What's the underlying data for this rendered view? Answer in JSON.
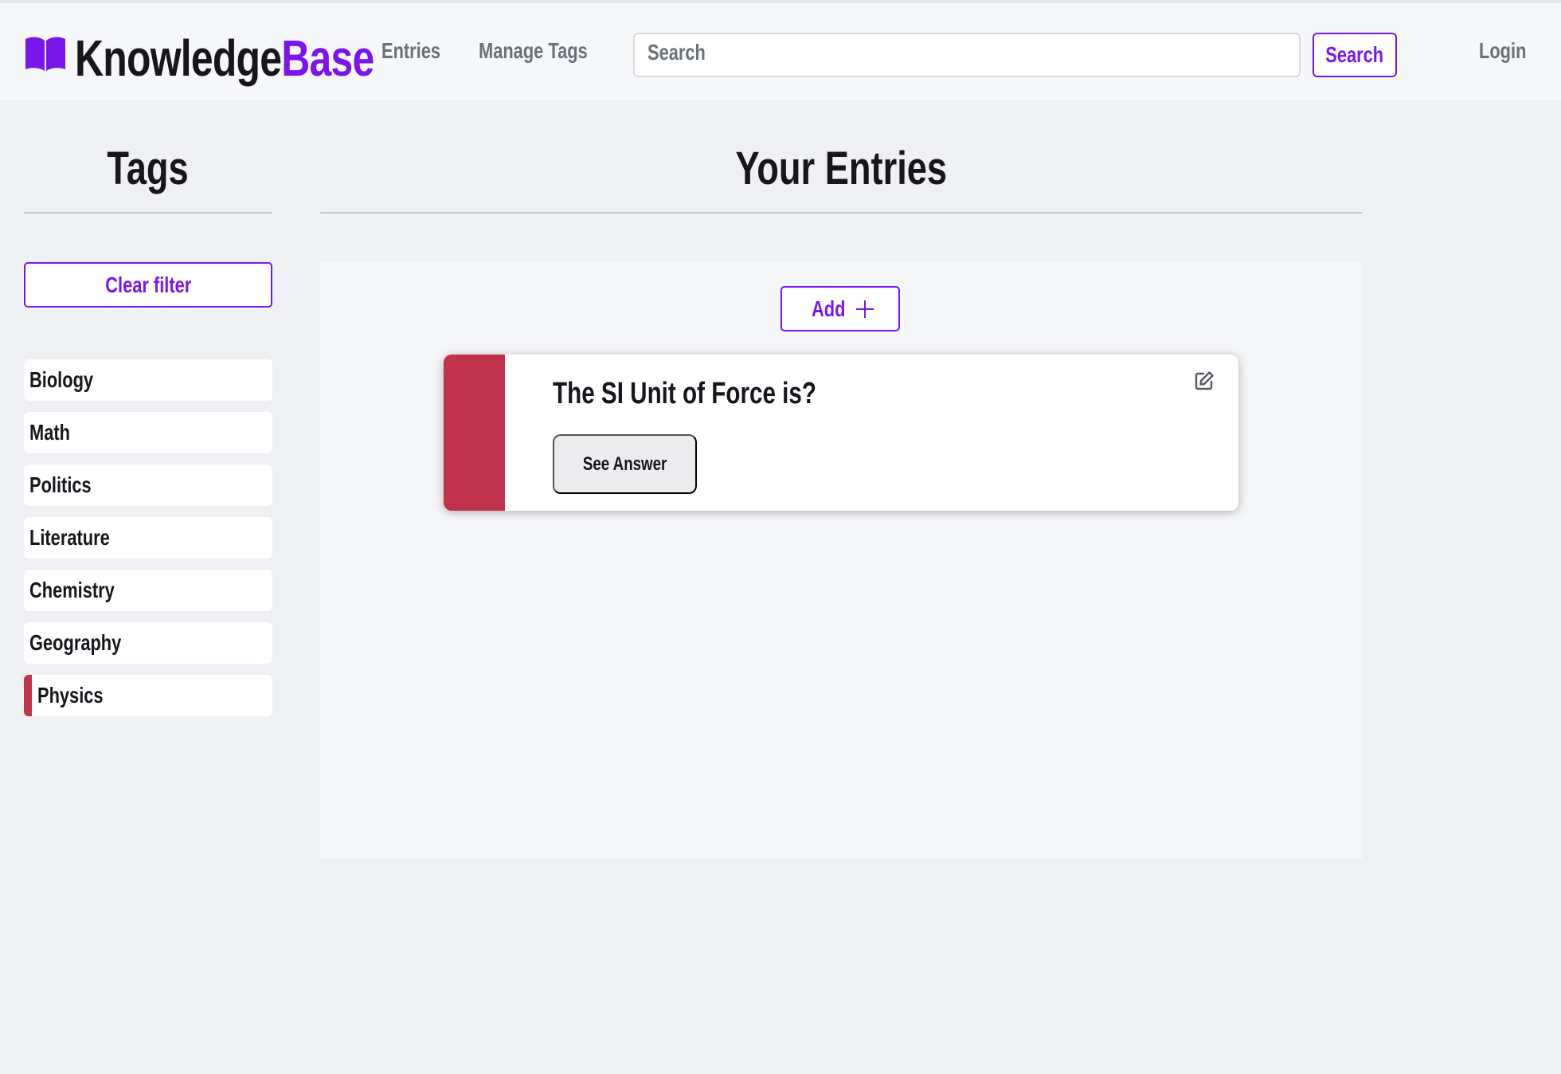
{
  "header": {
    "logo": {
      "part1": "Knowledge",
      "part2": "Base",
      "icon": "book-icon"
    },
    "nav": [
      {
        "label": "Entries"
      },
      {
        "label": "Manage Tags"
      }
    ],
    "search": {
      "placeholder": "Search",
      "value": "",
      "button_label": "Search"
    },
    "login_label": "Login"
  },
  "sidebar": {
    "title": "Tags",
    "clear_label": "Clear filter",
    "tags": [
      {
        "label": "Biology",
        "active": false
      },
      {
        "label": "Math",
        "active": false
      },
      {
        "label": "Politics",
        "active": false
      },
      {
        "label": "Literature",
        "active": false
      },
      {
        "label": "Chemistry",
        "active": false
      },
      {
        "label": "Geography",
        "active": false
      },
      {
        "label": "Physics",
        "active": true,
        "color": "#c0334a"
      }
    ]
  },
  "main": {
    "title": "Your Entries",
    "add_label": "Add",
    "entries": [
      {
        "question": "The SI Unit of Force is?",
        "answer_button": "See Answer",
        "tag_color": "#c0334a",
        "edit_icon": "edit-icon"
      }
    ]
  },
  "colors": {
    "accent": "#7a16ec",
    "physics": "#c0334a",
    "background": "#eef0f4",
    "header_bg": "#f6f7f9"
  }
}
